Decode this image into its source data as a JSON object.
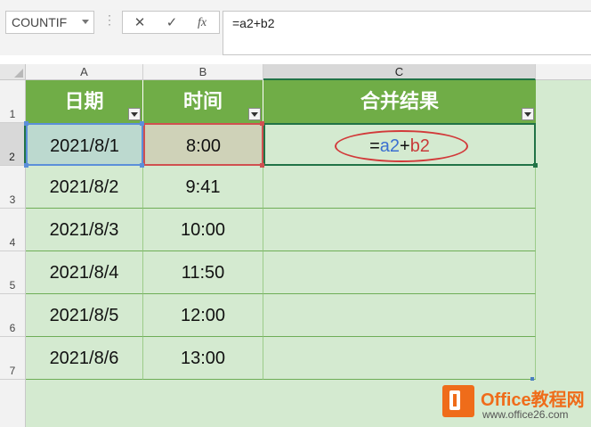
{
  "formula_bar": {
    "name_box": "COUNTIF",
    "more_dots": "⋮",
    "cancel_glyph": "✕",
    "enter_glyph": "✓",
    "fx_glyph": "fx",
    "formula": "=a2+b2"
  },
  "columns": [
    "A",
    "B",
    "C"
  ],
  "rows": [
    "1",
    "2",
    "3",
    "4",
    "5",
    "6",
    "7"
  ],
  "table": {
    "headers": [
      "日期",
      "时间",
      "合并结果"
    ],
    "data": [
      {
        "date": "2021/8/1",
        "time": "8:00"
      },
      {
        "date": "2021/8/2",
        "time": "9:41"
      },
      {
        "date": "2021/8/3",
        "time": "10:00"
      },
      {
        "date": "2021/8/4",
        "time": "11:50"
      },
      {
        "date": "2021/8/5",
        "time": "12:00"
      },
      {
        "date": "2021/8/6",
        "time": "13:00"
      }
    ],
    "editing_formula": {
      "eq": "=",
      "ref_a": "a2",
      "plus": "+",
      "ref_b": "b2"
    }
  },
  "colors": {
    "header_fill": "#70ad47",
    "cell_fill": "#d4ead0",
    "ref_a": "#3b6fd1",
    "ref_b": "#c83a3a",
    "highlight_oval": "#d23a3a"
  },
  "watermark": {
    "title": "Office教程网",
    "url": "www.office26.com"
  }
}
